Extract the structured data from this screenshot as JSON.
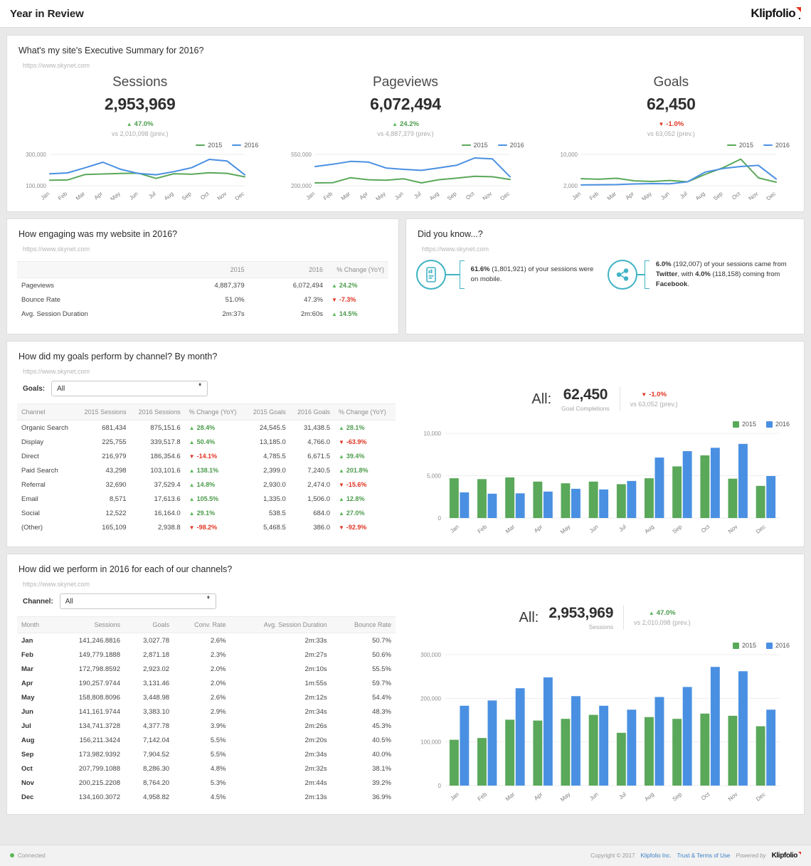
{
  "header": {
    "title": "Year in Review",
    "logo": "Klipfolio"
  },
  "months": [
    "Jan",
    "Feb",
    "Mar",
    "Apr",
    "May",
    "Jun",
    "Jul",
    "Aug",
    "Sep",
    "Oct",
    "Nov",
    "Dec"
  ],
  "legend": {
    "s2015": "2015",
    "s2016": "2016"
  },
  "colors": {
    "green": "#5aa85a",
    "blue": "#4a90e2",
    "up": "#5cb85c",
    "down": "#e23423",
    "teal": "#3fb3c4",
    "link": "#3b7fc4"
  },
  "exec": {
    "title": "What's my site's Executive Summary for 2016?",
    "url": "https://www.skynet.com",
    "kpis": [
      {
        "label": "Sessions",
        "value": "2,953,969",
        "delta": "47.0%",
        "dir": "up",
        "prev": "vs 2,010,098 (prev.)"
      },
      {
        "label": "Pageviews",
        "value": "6,072,494",
        "delta": "24.2%",
        "dir": "up",
        "prev": "vs 4,887,379 (prev.)"
      },
      {
        "label": "Goals",
        "value": "62,450",
        "delta": "-1.0%",
        "dir": "down",
        "prev": "vs 63,052 (prev.)"
      }
    ]
  },
  "engage": {
    "title": "How engaging was my website in 2016?",
    "url": "https://www.skynet.com",
    "columns": [
      "",
      "2015",
      "2016",
      "% Change (YoY)"
    ],
    "rows": [
      {
        "label": "Pageviews",
        "v2015": "4,887,379",
        "v2016": "6,072,494",
        "chg": "24.2%",
        "dir": "up"
      },
      {
        "label": "Bounce Rate",
        "v2015": "51.0%",
        "v2016": "47.3%",
        "chg": "-7.3%",
        "dir": "down"
      },
      {
        "label": "Avg. Session Duration",
        "v2015": "2m:37s",
        "v2016": "2m:60s",
        "chg": "14.5%",
        "dir": "up"
      }
    ]
  },
  "dyk": {
    "title": "Did you know...?",
    "url": "https://www.skynet.com",
    "facts": [
      {
        "icon": "mobile-phone-icon",
        "lead": "61.6%",
        "paren": "(1,801,921)",
        "rest": " of your sessions were on mobile."
      },
      {
        "icon": "share-network-icon",
        "html": "share"
      }
    ],
    "fact2": {
      "p1": "6.0%",
      "p2": " (192,007) of your sessions came from ",
      "p3": "Twitter",
      "p4": ", with ",
      "p5": "4.0%",
      "p6": " (118,158) coming from ",
      "p7": "Facebook",
      "p8": "."
    }
  },
  "goals_section": {
    "title": "How did my goals perform by channel? By month?",
    "url": "https://www.skynet.com",
    "filter_label": "Goals:",
    "filter_value": "All",
    "summary": {
      "prefix": "All:",
      "value": "62,450",
      "caption": "Goal Completions",
      "delta": "-1.0%",
      "dir": "down",
      "prev": "vs 63,052 (prev.)"
    },
    "columns": [
      "Channel",
      "2015 Sessions",
      "2016 Sessions",
      "% Change (YoY)",
      "2015 Goals",
      "2016 Goals",
      "% Change (YoY)"
    ],
    "rows": [
      {
        "channel": "Organic Search",
        "s2015": "681,434",
        "s2016": "875,151.6",
        "schg": "28.4%",
        "sdir": "up",
        "g2015": "24,545.5",
        "g2016": "31,438.5",
        "gchg": "28.1%",
        "gdir": "up"
      },
      {
        "channel": "Display",
        "s2015": "225,755",
        "s2016": "339,517.8",
        "schg": "50.4%",
        "sdir": "up",
        "g2015": "13,185.0",
        "g2016": "4,766.0",
        "gchg": "-63.9%",
        "gdir": "down"
      },
      {
        "channel": "Direct",
        "s2015": "216,979",
        "s2016": "186,354.6",
        "schg": "-14.1%",
        "sdir": "down",
        "g2015": "4,785.5",
        "g2016": "6,671.5",
        "gchg": "39.4%",
        "gdir": "up"
      },
      {
        "channel": "Paid Search",
        "s2015": "43,298",
        "s2016": "103,101.6",
        "schg": "138.1%",
        "sdir": "up",
        "g2015": "2,399.0",
        "g2016": "7,240.5",
        "gchg": "201.8%",
        "gdir": "up"
      },
      {
        "channel": "Referral",
        "s2015": "32,690",
        "s2016": "37,529.4",
        "schg": "14.8%",
        "sdir": "up",
        "g2015": "2,930.0",
        "g2016": "2,474.0",
        "gchg": "-15.6%",
        "gdir": "down"
      },
      {
        "channel": "Email",
        "s2015": "8,571",
        "s2016": "17,613.6",
        "schg": "105.5%",
        "sdir": "up",
        "g2015": "1,335.0",
        "g2016": "1,506.0",
        "gchg": "12.8%",
        "gdir": "up"
      },
      {
        "channel": "Social",
        "s2015": "12,522",
        "s2016": "16,164.0",
        "schg": "29.1%",
        "sdir": "up",
        "g2015": "538.5",
        "g2016": "684.0",
        "gchg": "27.0%",
        "gdir": "up"
      },
      {
        "channel": "(Other)",
        "s2015": "165,109",
        "s2016": "2,938.8",
        "schg": "-98.2%",
        "sdir": "down",
        "g2015": "5,468.5",
        "g2016": "386.0",
        "gchg": "-92.9%",
        "gdir": "down"
      }
    ]
  },
  "channels_section": {
    "title": "How did we perform in 2016 for each of our channels?",
    "url": "https://www.skynet.com",
    "filter_label": "Channel:",
    "filter_value": "All",
    "summary": {
      "prefix": "All:",
      "value": "2,953,969",
      "caption": "Sessions",
      "delta": "47.0%",
      "dir": "up",
      "prev": "vs 2,010,098 (prev.)"
    },
    "columns": [
      "Month",
      "Sessions",
      "Goals",
      "Conv. Rate",
      "Avg. Session Duration",
      "Bounce Rate"
    ],
    "rows": [
      {
        "month": "Jan",
        "sessions": "141,246.8816",
        "goals": "3,027.78",
        "conv": "2.6%",
        "dur": "2m:33s",
        "bounce": "50.7%"
      },
      {
        "month": "Feb",
        "sessions": "149,779.1888",
        "goals": "2,871.18",
        "conv": "2.3%",
        "dur": "2m:27s",
        "bounce": "50.6%"
      },
      {
        "month": "Mar",
        "sessions": "172,798.8592",
        "goals": "2,923.02",
        "conv": "2.0%",
        "dur": "2m:10s",
        "bounce": "55.5%"
      },
      {
        "month": "Apr",
        "sessions": "190,257.9744",
        "goals": "3,131.46",
        "conv": "2.0%",
        "dur": "1m:55s",
        "bounce": "59.7%"
      },
      {
        "month": "May",
        "sessions": "158,808.8096",
        "goals": "3,448.98",
        "conv": "2.6%",
        "dur": "2m:12s",
        "bounce": "54.4%"
      },
      {
        "month": "Jun",
        "sessions": "141,161.9744",
        "goals": "3,383.10",
        "conv": "2.9%",
        "dur": "2m:34s",
        "bounce": "48.3%"
      },
      {
        "month": "Jul",
        "sessions": "134,741.3728",
        "goals": "4,377.78",
        "conv": "3.9%",
        "dur": "2m:26s",
        "bounce": "45.3%"
      },
      {
        "month": "Aug",
        "sessions": "156,211.3424",
        "goals": "7,142.04",
        "conv": "5.5%",
        "dur": "2m:20s",
        "bounce": "40.5%"
      },
      {
        "month": "Sep",
        "sessions": "173,982.9392",
        "goals": "7,904.52",
        "conv": "5.5%",
        "dur": "2m:34s",
        "bounce": "40.0%"
      },
      {
        "month": "Oct",
        "sessions": "207,799.1088",
        "goals": "8,286.30",
        "conv": "4.8%",
        "dur": "2m:32s",
        "bounce": "38.1%"
      },
      {
        "month": "Nov",
        "sessions": "200,215.2208",
        "goals": "8,764.20",
        "conv": "5.3%",
        "dur": "2m:44s",
        "bounce": "39.2%"
      },
      {
        "month": "Dec",
        "sessions": "134,160.3072",
        "goals": "4,958.82",
        "conv": "4.5%",
        "dur": "2m:13s",
        "bounce": "36.9%"
      }
    ]
  },
  "footer": {
    "status": "Connected",
    "copyright": "Copyright © 2017",
    "company": "Klipfolio Inc.",
    "terms": "Trust & Terms of Use",
    "powered": "Powered by",
    "logo": "Klipfolio"
  },
  "chart_data": [
    {
      "type": "line",
      "name": "sessions-sparkline",
      "title": "Sessions",
      "x": [
        "Jan",
        "Feb",
        "Mar",
        "Apr",
        "May",
        "Jun",
        "Jul",
        "Aug",
        "Sep",
        "Oct",
        "Nov",
        "Dec"
      ],
      "ylim": [
        100000,
        300000
      ],
      "yticks": [
        100000,
        300000
      ],
      "yticklabels": [
        "100,000",
        "300,000"
      ],
      "legend": "top-right",
      "series": [
        {
          "name": "2015",
          "color": "#5aa85a",
          "values": [
            135000,
            137000,
            172000,
            175000,
            178000,
            180000,
            147000,
            177000,
            173000,
            183000,
            179000,
            157000
          ]
        },
        {
          "name": "2016",
          "color": "#4a90e2",
          "values": [
            176000,
            182000,
            215000,
            250000,
            205000,
            178000,
            170000,
            190000,
            215000,
            268000,
            258000,
            170000
          ]
        }
      ]
    },
    {
      "type": "line",
      "name": "pageviews-sparkline",
      "title": "Pageviews",
      "x": [
        "Jan",
        "Feb",
        "Mar",
        "Apr",
        "May",
        "Jun",
        "Jul",
        "Aug",
        "Sep",
        "Oct",
        "Nov",
        "Dec"
      ],
      "ylim": [
        200000,
        550000
      ],
      "yticks": [
        200000,
        550000
      ],
      "yticklabels": [
        "200,000",
        "550,000"
      ],
      "legend": "top-right",
      "series": [
        {
          "name": "2015",
          "color": "#5aa85a",
          "values": [
            232000,
            234000,
            290000,
            267000,
            262000,
            277000,
            232000,
            268000,
            285000,
            305000,
            300000,
            270000
          ]
        },
        {
          "name": "2016",
          "color": "#4a90e2",
          "values": [
            415000,
            440000,
            472000,
            465000,
            398000,
            383000,
            372000,
            400000,
            430000,
            510000,
            500000,
            300000
          ]
        }
      ]
    },
    {
      "type": "line",
      "name": "goals-sparkline",
      "title": "Goals",
      "x": [
        "Jan",
        "Feb",
        "Mar",
        "Apr",
        "May",
        "Jun",
        "Jul",
        "Aug",
        "Sep",
        "Oct",
        "Nov",
        "Dec"
      ],
      "ylim": [
        2000,
        10000
      ],
      "yticks": [
        2000,
        10000
      ],
      "yticklabels": [
        "2,000",
        "10,000"
      ],
      "legend": "top-right",
      "series": [
        {
          "name": "2015",
          "color": "#5aa85a",
          "values": [
            3800,
            3650,
            3900,
            3250,
            3100,
            3350,
            3000,
            4900,
            6600,
            8800,
            4000,
            2900
          ]
        },
        {
          "name": "2016",
          "color": "#4a90e2",
          "values": [
            2200,
            2250,
            2300,
            2450,
            2550,
            2500,
            3000,
            5500,
            6400,
            6900,
            7200,
            3700
          ]
        }
      ]
    },
    {
      "type": "bar",
      "name": "goals-by-month-bar",
      "categories": [
        "Jan",
        "Feb",
        "Mar",
        "Apr",
        "May",
        "Jun",
        "Jul",
        "Aug",
        "Sep",
        "Oct",
        "Nov",
        "Dec"
      ],
      "ylim": [
        0,
        10000
      ],
      "yticks": [
        0,
        5000,
        10000
      ],
      "yticklabels": [
        "0",
        "5,000",
        "10,000"
      ],
      "legend": "top-right",
      "series": [
        {
          "name": "2015",
          "color": "#5aa85a",
          "values": [
            4700,
            4600,
            4800,
            4300,
            4100,
            4300,
            4000,
            4700,
            6100,
            7400,
            4650,
            3800
          ]
        },
        {
          "name": "2016",
          "color": "#4a90e2",
          "values": [
            3030,
            2870,
            2920,
            3130,
            3450,
            3380,
            4380,
            7140,
            7900,
            8290,
            8760,
            4960
          ]
        }
      ]
    },
    {
      "type": "bar",
      "name": "sessions-by-month-bar",
      "categories": [
        "Jan",
        "Feb",
        "Mar",
        "Apr",
        "May",
        "Jun",
        "Jul",
        "Aug",
        "Sep",
        "Oct",
        "Nov",
        "Dec"
      ],
      "ylim": [
        0,
        300000
      ],
      "yticks": [
        0,
        100000,
        200000,
        300000
      ],
      "yticklabels": [
        "0",
        "100,000",
        "200,000",
        "300,000"
      ],
      "legend": "top-right",
      "series": [
        {
          "name": "2015",
          "color": "#5aa85a",
          "values": [
            105000,
            109000,
            151000,
            149000,
            153000,
            162000,
            121000,
            157000,
            153000,
            165000,
            160000,
            136000
          ]
        },
        {
          "name": "2016",
          "color": "#4a90e2",
          "values": [
            183000,
            195000,
            223000,
            248000,
            205000,
            183000,
            174000,
            203000,
            226000,
            272000,
            262000,
            174000
          ]
        }
      ]
    }
  ]
}
